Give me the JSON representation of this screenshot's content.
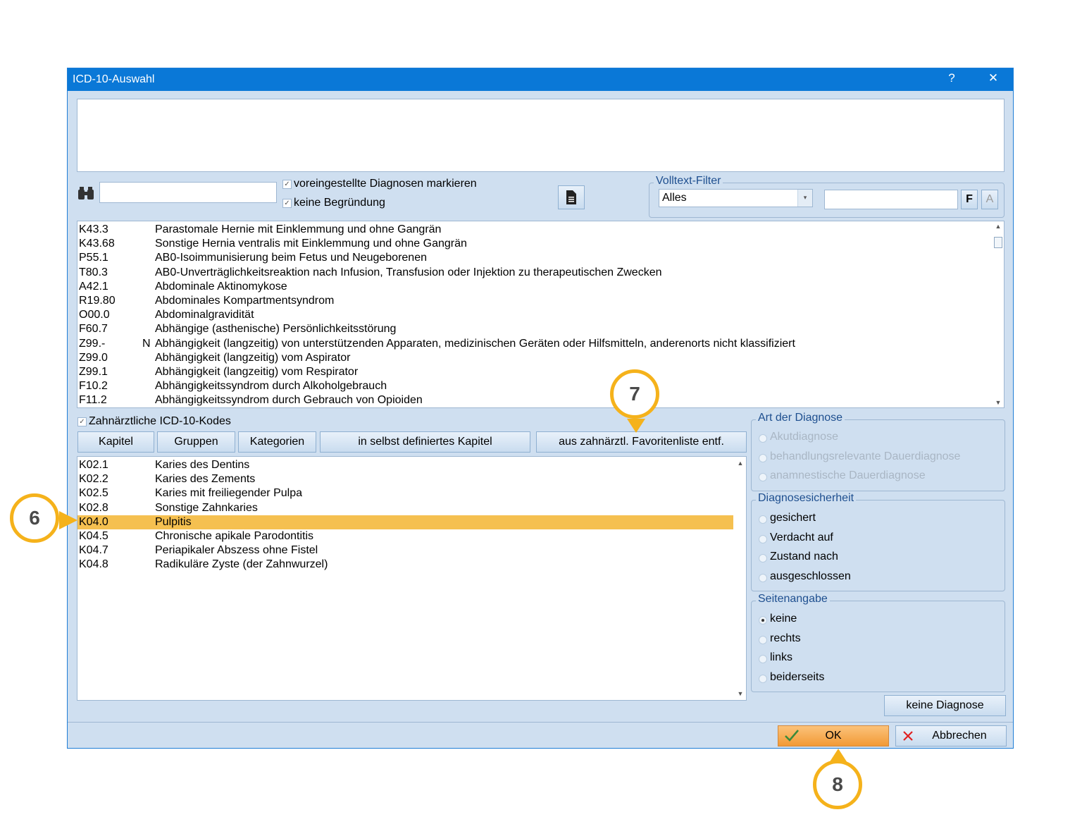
{
  "window": {
    "title": "ICD-10-Auswahl",
    "help": "?",
    "close": "✕"
  },
  "search": {
    "value": "",
    "check_preset": "voreingestellte Diagnosen markieren",
    "check_reason": "keine Begründung"
  },
  "fulltext": {
    "group_title": "Volltext-Filter",
    "select_value": "Alles",
    "input_value": "",
    "btn_f": "F",
    "btn_a": "A"
  },
  "all_codes": [
    {
      "code": "K43.3",
      "flag": "",
      "desc": "Parastomale Hernie mit Einklemmung und ohne Gangrän"
    },
    {
      "code": "K43.68",
      "flag": "",
      "desc": "Sonstige Hernia ventralis mit Einklemmung und ohne Gangrän"
    },
    {
      "code": "P55.1",
      "flag": "",
      "desc": "AB0-Isoimmunisierung beim Fetus und Neugeborenen"
    },
    {
      "code": "T80.3",
      "flag": "",
      "desc": "AB0-Unverträglichkeitsreaktion nach Infusion, Transfusion oder Injektion zu therapeutischen Zwecken"
    },
    {
      "code": "A42.1",
      "flag": "",
      "desc": "Abdominale Aktinomykose"
    },
    {
      "code": "R19.80",
      "flag": "",
      "desc": "Abdominales Kompartmentsyndrom"
    },
    {
      "code": "O00.0",
      "flag": "",
      "desc": "Abdominalgravidität"
    },
    {
      "code": "F60.7",
      "flag": "",
      "desc": "Abhängige (asthenische) Persönlichkeitsstörung"
    },
    {
      "code": "Z99.-",
      "flag": "N",
      "desc": "Abhängigkeit (langzeitig) von unterstützenden Apparaten, medizinischen Geräten oder Hilfsmitteln, anderenorts nicht klassifiziert"
    },
    {
      "code": "Z99.0",
      "flag": "",
      "desc": "Abhängigkeit (langzeitig) vom Aspirator"
    },
    {
      "code": "Z99.1",
      "flag": "",
      "desc": "Abhängigkeit (langzeitig) vom Respirator"
    },
    {
      "code": "F10.2",
      "flag": "",
      "desc": "Abhängigkeitssyndrom durch Alkoholgebrauch"
    },
    {
      "code": "F11.2",
      "flag": "",
      "desc": "Abhängigkeitssyndrom durch Gebrauch von Opioiden"
    }
  ],
  "dental": {
    "check_label": "Zahnärztliche ICD-10-Kodes",
    "buttons": {
      "kapitel": "Kapitel",
      "gruppen": "Gruppen",
      "kategorien": "Kategorien",
      "own_chapter": "in selbst definiertes Kapitel",
      "remove_fav": "aus zahnärztl. Favoritenliste entf."
    },
    "rows": [
      {
        "code": "K02.1",
        "desc": "Karies des Dentins"
      },
      {
        "code": "K02.2",
        "desc": "Karies des Zements"
      },
      {
        "code": "K02.5",
        "desc": "Karies mit freiliegender Pulpa"
      },
      {
        "code": "K02.8",
        "desc": "Sonstige Zahnkaries"
      },
      {
        "code": "K04.0",
        "desc": "Pulpitis"
      },
      {
        "code": "K04.5",
        "desc": "Chronische apikale Parodontitis"
      },
      {
        "code": "K04.7",
        "desc": "Periapikaler Abszess ohne Fistel"
      },
      {
        "code": "K04.8",
        "desc": "Radikuläre Zyste (der Zahnwurzel)"
      }
    ],
    "selected_code": "K04.0"
  },
  "art": {
    "title": "Art der Diagnose",
    "options": [
      "Akutdiagnose",
      "behandlungsrelevante Dauerdiagnose",
      "anamnestische Dauerdiagnose"
    ]
  },
  "sicherheit": {
    "title": "Diagnosesicherheit",
    "options": [
      "gesichert",
      "Verdacht auf",
      "Zustand nach",
      "ausgeschlossen"
    ]
  },
  "seite": {
    "title": "Seitenangabe",
    "options": [
      "keine",
      "rechts",
      "links",
      "beiderseits"
    ],
    "selected": "keine"
  },
  "buttons": {
    "keine_diagnose": "keine Diagnose",
    "ok": "OK",
    "cancel": "Abbrechen"
  },
  "callouts": {
    "c6": "6",
    "c7": "7",
    "c8": "8"
  },
  "colors": {
    "titlebar": "#0a78d7",
    "selection": "#f5c050",
    "callout": "#f5b21b",
    "ok_button": "#f6a846"
  }
}
